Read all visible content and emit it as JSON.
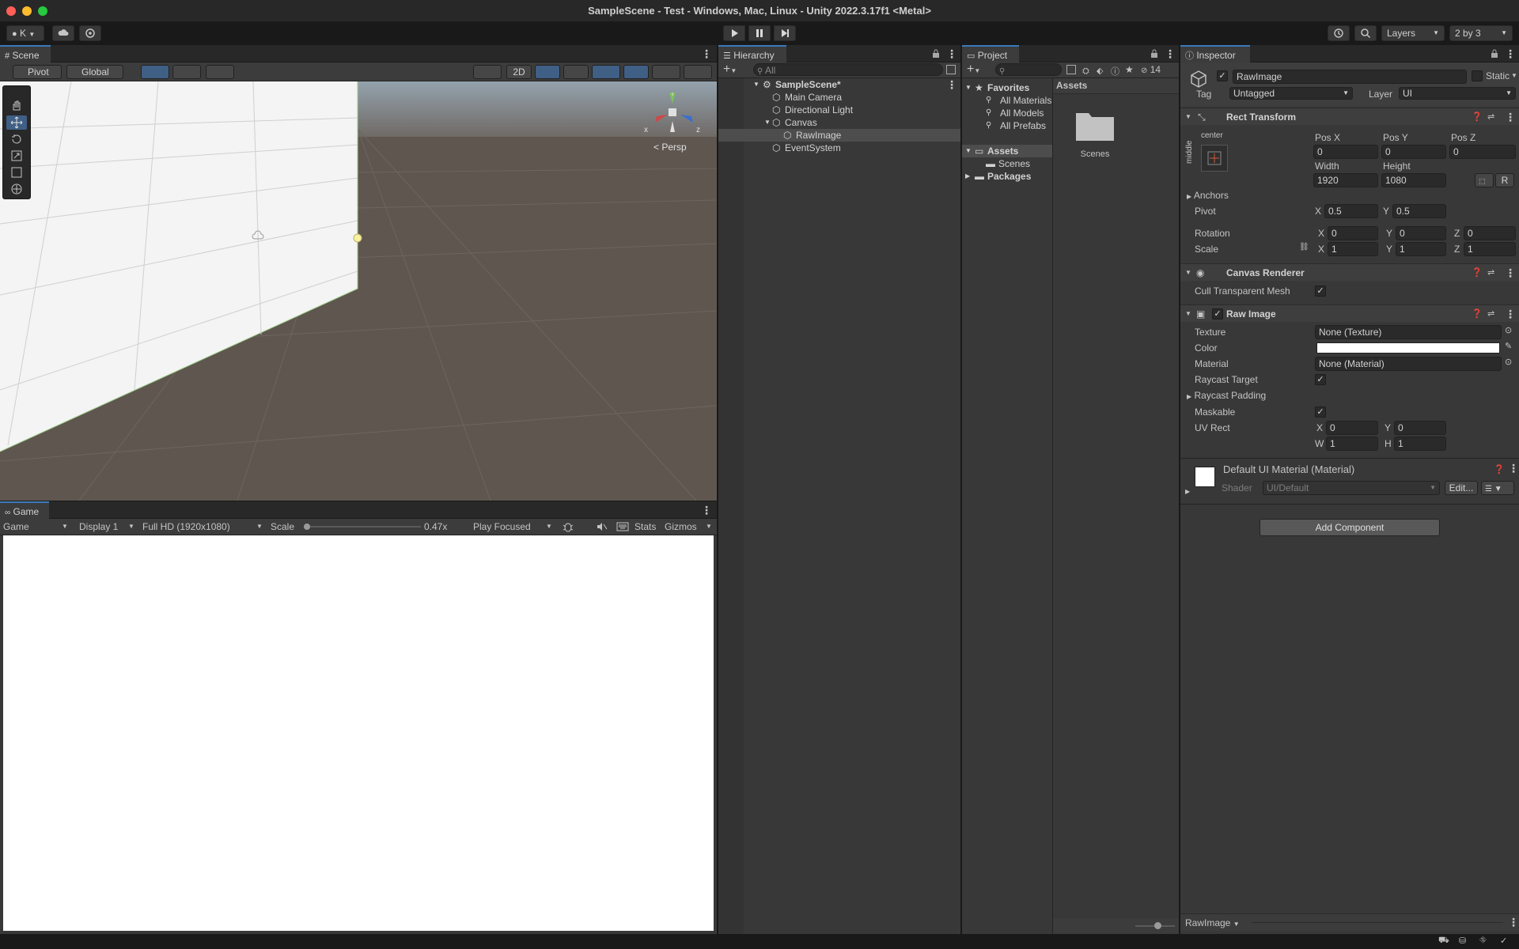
{
  "window": {
    "title": "SampleScene - Test - Windows, Mac, Linux - Unity 2022.3.17f1 <Metal>"
  },
  "toolbar": {
    "account": "K",
    "layers": "Layers",
    "layout": "2 by 3"
  },
  "scene": {
    "tab": "Scene",
    "pivot": "Pivot",
    "global": "Global",
    "mode2d": "2D",
    "persp": "Persp",
    "gizmo_x": "x",
    "gizmo_z": "z"
  },
  "game": {
    "tab": "Game",
    "view": "Game",
    "display": "Display 1",
    "resolution": "Full HD (1920x1080)",
    "scale_label": "Scale",
    "scale_value": "0.47x",
    "play_mode": "Play Focused",
    "stats": "Stats",
    "gizmos": "Gizmos"
  },
  "hierarchy": {
    "tab": "Hierarchy",
    "search_placeholder": "All",
    "scene": "SampleScene*",
    "items": [
      "Main Camera",
      "Directional Light",
      "Canvas",
      "RawImage",
      "EventSystem"
    ]
  },
  "project": {
    "tab": "Project",
    "hidden_count": "14",
    "favorites": "Favorites",
    "favorite_items": [
      "All Materials",
      "All Models",
      "All Prefabs"
    ],
    "assets": "Assets",
    "scenes": "Scenes",
    "packages": "Packages",
    "breadcrumb": "Assets",
    "folder_label": "Scenes"
  },
  "inspector": {
    "tab": "Inspector",
    "object_name": "RawImage",
    "static": "Static",
    "tag_label": "Tag",
    "tag_value": "Untagged",
    "layer_label": "Layer",
    "layer_value": "UI",
    "rect": {
      "title": "Rect Transform",
      "anchor_h": "center",
      "anchor_v": "middle",
      "posx_label": "Pos X",
      "posx": "0",
      "posy_label": "Pos Y",
      "posy": "0",
      "posz_label": "Pos Z",
      "posz": "0",
      "width_label": "Width",
      "width": "1920",
      "height_label": "Height",
      "height": "1080",
      "r_btn": "R",
      "anchors": "Anchors",
      "pivot": "Pivot",
      "pivot_x": "0.5",
      "pivot_y": "0.5",
      "rotation": "Rotation",
      "rot_x": "0",
      "rot_y": "0",
      "rot_z": "0",
      "scale": "Scale",
      "scale_x": "1",
      "scale_y": "1",
      "scale_z": "1",
      "x": "X",
      "y": "Y",
      "z": "Z"
    },
    "canvas_renderer": {
      "title": "Canvas Renderer",
      "cull": "Cull Transparent Mesh"
    },
    "raw_image": {
      "title": "Raw Image",
      "texture_label": "Texture",
      "texture_value": "None (Texture)",
      "color_label": "Color",
      "material_label": "Material",
      "material_value": "None (Material)",
      "raycast_target": "Raycast Target",
      "raycast_padding": "Raycast Padding",
      "maskable": "Maskable",
      "uv_rect": "UV Rect",
      "uv_x": "0",
      "uv_y": "0",
      "uv_w": "1",
      "uv_h": "1",
      "w": "W",
      "h": "H"
    },
    "material": {
      "title": "Default UI Material (Material)",
      "shader_label": "Shader",
      "shader_value": "UI/Default",
      "edit": "Edit..."
    },
    "add_component": "Add Component",
    "footer": "RawImage"
  },
  "colors": {
    "accent": "#3a79bb",
    "selection": "#4d4d4d",
    "panel": "#383838"
  }
}
